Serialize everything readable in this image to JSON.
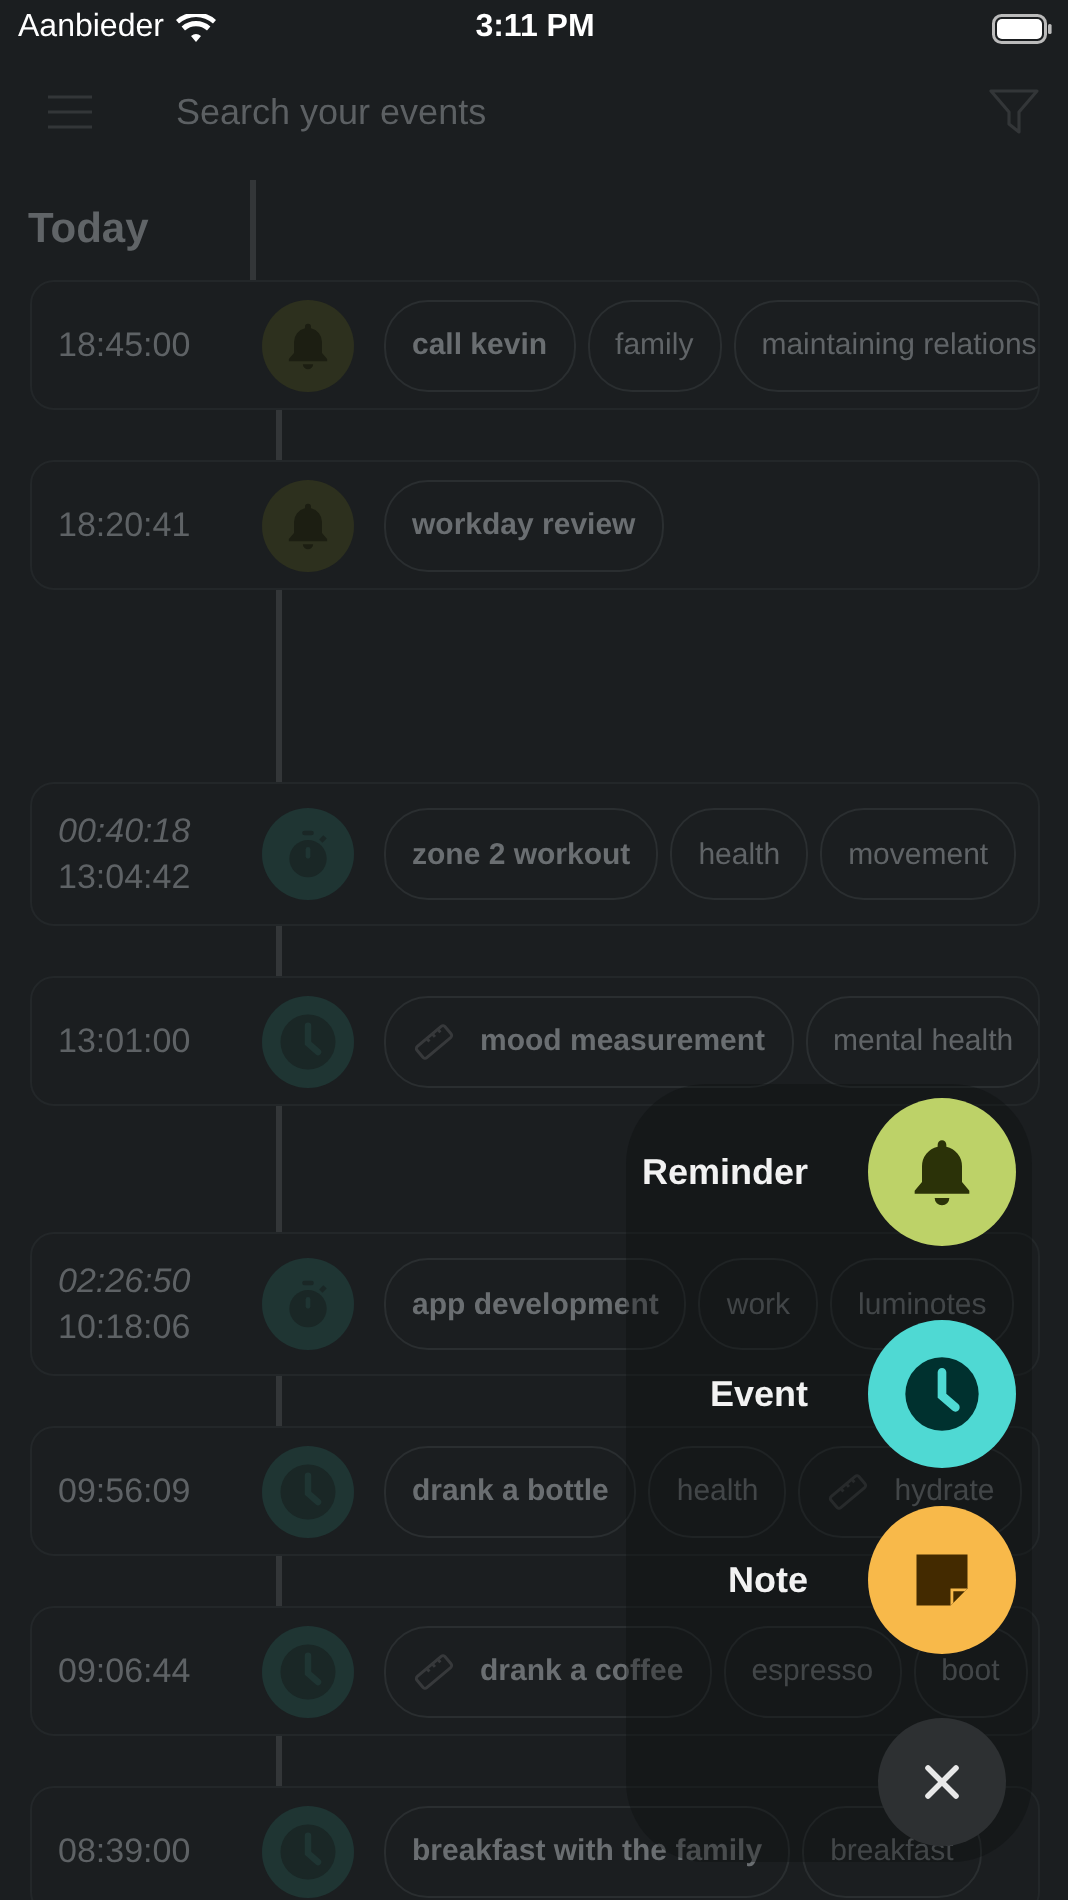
{
  "status_bar": {
    "carrier": "Aanbieder",
    "time": "3:11 PM"
  },
  "search": {
    "placeholder": "Search your events"
  },
  "section_title": "Today",
  "entries": [
    {
      "kind": "reminder",
      "time": "18:45:00",
      "chips": [
        {
          "label": "call kevin",
          "kind": "title",
          "measured": false
        },
        {
          "label": "family",
          "kind": "tag",
          "measured": false
        },
        {
          "label": "maintaining relations",
          "kind": "tag",
          "measured": false
        }
      ]
    },
    {
      "kind": "reminder",
      "time": "18:20:41",
      "chips": [
        {
          "label": "workday review",
          "kind": "title",
          "measured": false
        }
      ]
    },
    {
      "kind": "timer",
      "duration": "00:40:18",
      "time": "13:04:42",
      "chips": [
        {
          "label": "zone 2 workout",
          "kind": "title",
          "measured": false
        },
        {
          "label": "health",
          "kind": "tag",
          "measured": false
        },
        {
          "label": "movement",
          "kind": "tag",
          "measured": false
        }
      ]
    },
    {
      "kind": "event",
      "time": "13:01:00",
      "chips": [
        {
          "label": "mood measurement",
          "kind": "title",
          "measured": true
        },
        {
          "label": "mental health",
          "kind": "tag",
          "measured": false
        }
      ]
    },
    {
      "kind": "timer",
      "duration": "02:26:50",
      "time": "10:18:06",
      "chips": [
        {
          "label": "app development",
          "kind": "title",
          "measured": false
        },
        {
          "label": "work",
          "kind": "tag",
          "measured": false
        },
        {
          "label": "luminotes",
          "kind": "tag",
          "measured": false
        }
      ]
    },
    {
      "kind": "event",
      "time": "09:56:09",
      "chips": [
        {
          "label": "drank a bottle",
          "kind": "title",
          "measured": false
        },
        {
          "label": "health",
          "kind": "tag",
          "measured": false
        },
        {
          "label": "hydrate",
          "kind": "tag",
          "measured": true
        }
      ]
    },
    {
      "kind": "event",
      "time": "09:06:44",
      "chips": [
        {
          "label": "drank a coffee",
          "kind": "title",
          "measured": true
        },
        {
          "label": "espresso",
          "kind": "tag",
          "measured": false
        },
        {
          "label": "boot",
          "kind": "tag",
          "measured": false
        }
      ]
    },
    {
      "kind": "event",
      "time": "08:39:00",
      "chips": [
        {
          "label": "breakfast with the family",
          "kind": "title",
          "measured": false
        },
        {
          "label": "breakfast",
          "kind": "tag",
          "measured": false
        }
      ]
    }
  ],
  "actions": [
    {
      "kind": "reminder",
      "label": "Reminder"
    },
    {
      "kind": "event",
      "label": "Event"
    },
    {
      "kind": "note",
      "label": "Note"
    }
  ]
}
